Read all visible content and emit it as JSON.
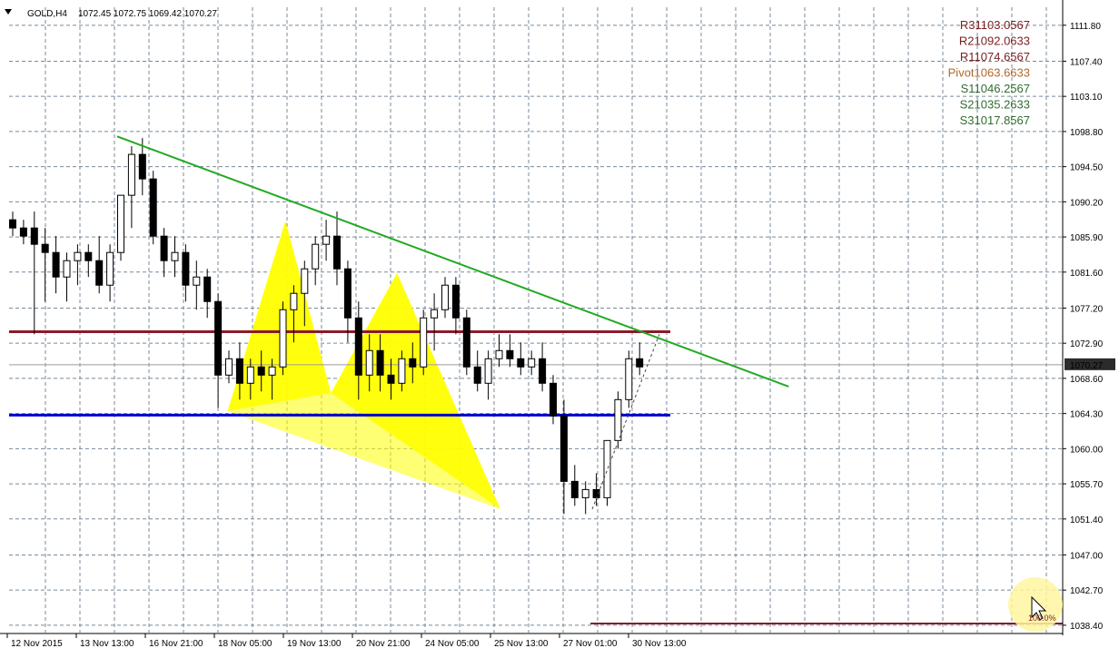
{
  "header": {
    "symbol": "GOLD,H4",
    "ohlc": "1072.45 1072.75 1069.42 1070.27"
  },
  "chart_data": {
    "type": "candlestick",
    "symbol": "GOLD",
    "timeframe": "H4",
    "ylim": [
      1037.5,
      1114.0
    ],
    "y_ticks": [
      "1111.80",
      "1107.40",
      "1103.10",
      "1098.80",
      "1094.50",
      "1090.20",
      "1085.90",
      "1081.60",
      "1077.20",
      "1072.90",
      "1068.60",
      "1064.30",
      "1060.00",
      "1055.70",
      "1051.40",
      "1047.00",
      "1042.70",
      "1038.40"
    ],
    "current_price": "1070.27",
    "x_labels": [
      "12 Nov 2015",
      "13 Nov 13:00",
      "16 Nov 21:00",
      "18 Nov 05:00",
      "19 Nov 13:00",
      "20 Nov 21:00",
      "24 Nov 05:00",
      "25 Nov 13:00",
      "27 Nov 01:00",
      "30 Nov 13:00"
    ],
    "grid": true,
    "colors": {
      "candle": "#000000",
      "trendline": "#22aa22",
      "resistance_line": "#8b1a2a",
      "support_line": "#0000cc",
      "pattern_fill": "#ffff00",
      "grid": "#7a8a99",
      "cursor_highlight": "#fff6a0"
    },
    "candles": [
      [
        1088,
        1089,
        1086,
        1087
      ],
      [
        1087,
        1088,
        1085,
        1086
      ],
      [
        1087,
        1089,
        1074,
        1085
      ],
      [
        1085,
        1087,
        1078,
        1084
      ],
      [
        1084,
        1086,
        1079,
        1081
      ],
      [
        1081,
        1084,
        1078,
        1083
      ],
      [
        1083,
        1085,
        1080,
        1084
      ],
      [
        1084,
        1085,
        1081,
        1083
      ],
      [
        1083,
        1086,
        1079,
        1080
      ],
      [
        1080,
        1085,
        1078,
        1084
      ],
      [
        1084,
        1091,
        1083,
        1091
      ],
      [
        1091,
        1097,
        1087,
        1096
      ],
      [
        1096,
        1098,
        1091,
        1093
      ],
      [
        1093,
        1094,
        1085,
        1086
      ],
      [
        1086,
        1087,
        1081,
        1083
      ],
      [
        1083,
        1086,
        1081,
        1084
      ],
      [
        1084,
        1085,
        1078,
        1080
      ],
      [
        1080,
        1083,
        1077,
        1081
      ],
      [
        1081,
        1082,
        1076,
        1078
      ],
      [
        1078,
        1079,
        1065,
        1069
      ],
      [
        1069,
        1072,
        1068,
        1071
      ],
      [
        1071,
        1073,
        1066,
        1068
      ],
      [
        1068,
        1071,
        1066,
        1070
      ],
      [
        1070,
        1072,
        1067,
        1069
      ],
      [
        1069,
        1071,
        1066,
        1070
      ],
      [
        1070,
        1078,
        1069,
        1077
      ],
      [
        1077,
        1080,
        1073,
        1079
      ],
      [
        1079,
        1083,
        1075,
        1082
      ],
      [
        1082,
        1086,
        1080,
        1085
      ],
      [
        1085,
        1088,
        1083,
        1086
      ],
      [
        1086,
        1089,
        1080,
        1082
      ],
      [
        1082,
        1083,
        1073,
        1076
      ],
      [
        1076,
        1078,
        1066,
        1069
      ],
      [
        1069,
        1074,
        1067,
        1072
      ],
      [
        1072,
        1074,
        1067,
        1069
      ],
      [
        1069,
        1071,
        1066,
        1068
      ],
      [
        1068,
        1072,
        1067,
        1071
      ],
      [
        1071,
        1073,
        1068,
        1070
      ],
      [
        1070,
        1077,
        1069,
        1076
      ],
      [
        1076,
        1079,
        1072,
        1077
      ],
      [
        1077,
        1081,
        1076,
        1080
      ],
      [
        1080,
        1081,
        1074,
        1076
      ],
      [
        1076,
        1077,
        1069,
        1070
      ],
      [
        1070,
        1072,
        1067,
        1068
      ],
      [
        1068,
        1072,
        1066,
        1071
      ],
      [
        1071,
        1074,
        1070,
        1072
      ],
      [
        1072,
        1074,
        1070,
        1071
      ],
      [
        1071,
        1073,
        1069,
        1070
      ],
      [
        1070,
        1072,
        1069,
        1071
      ],
      [
        1071,
        1073,
        1067,
        1068
      ],
      [
        1068,
        1069,
        1063,
        1064
      ],
      [
        1064,
        1066,
        1052,
        1056
      ],
      [
        1056,
        1058,
        1053,
        1054
      ],
      [
        1054,
        1056,
        1052,
        1055
      ],
      [
        1055,
        1057,
        1053,
        1054
      ],
      [
        1054,
        1061,
        1053,
        1061
      ],
      [
        1061,
        1067,
        1060,
        1066
      ],
      [
        1066,
        1072,
        1065,
        1071
      ],
      [
        1071,
        1073,
        1069,
        1070
      ]
    ],
    "trendline": [
      [
        1098.2,
        119
      ],
      [
        1067.6,
        190
      ]
    ],
    "resistance_level": 1074.3,
    "support_level": 1064.1,
    "pattern_points": [
      [
        1064.6,
        52
      ],
      [
        1087.9,
        66
      ],
      [
        1066.8,
        77
      ],
      [
        1081.5,
        93
      ],
      [
        1052.6,
        118
      ]
    ],
    "pivot_levels": [
      {
        "label": "R3",
        "value": "1103.0567",
        "color": "#7a1f1f"
      },
      {
        "label": "R2",
        "value": "1092.0633",
        "color": "#7a1f1f"
      },
      {
        "label": "R1",
        "value": "1074.6567",
        "color": "#7a1f1f"
      },
      {
        "label": "Pivot",
        "value": "1063.6633",
        "color": "#b06a2a"
      },
      {
        "label": "S1",
        "value": "1046.2567",
        "color": "#2f6e2f"
      },
      {
        "label": "S2",
        "value": "1035.2633",
        "color": "#2f6e2f"
      },
      {
        "label": "S3",
        "value": "1017.8567",
        "color": "#2f6e2f"
      }
    ],
    "bottom_line_label": "100.0%"
  }
}
